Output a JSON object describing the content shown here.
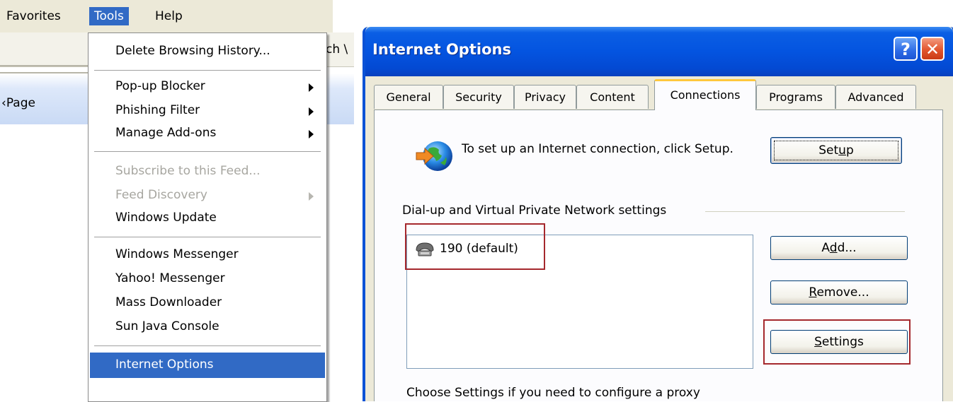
{
  "menubar": {
    "items": [
      "Favorites",
      "Tools",
      "Help"
    ]
  },
  "toolbar": {
    "page_label": "Page",
    "page_prefix": "‹",
    "search_fragment": "ch \\"
  },
  "tools_menu": {
    "items": [
      {
        "label": "Delete Browsing History...",
        "state": "enabled"
      },
      {
        "label": "Pop-up Blocker",
        "state": "enabled",
        "submenu": true
      },
      {
        "label": "Phishing Filter",
        "state": "enabled",
        "submenu": true
      },
      {
        "label": "Manage Add-ons",
        "state": "enabled",
        "submenu": true
      },
      {
        "label": "Subscribe to this Feed...",
        "state": "disabled"
      },
      {
        "label": "Feed Discovery",
        "state": "disabled",
        "submenu": true
      },
      {
        "label": "Windows Update",
        "state": "enabled"
      },
      {
        "label": "Windows Messenger",
        "state": "enabled"
      },
      {
        "label": "Yahoo! Messenger",
        "state": "enabled"
      },
      {
        "label": "Mass Downloader",
        "state": "enabled"
      },
      {
        "label": "Sun Java Console",
        "state": "enabled"
      },
      {
        "label": "Internet Options",
        "state": "selected"
      }
    ]
  },
  "dialog": {
    "title": "Internet Options",
    "help_glyph": "?",
    "close_glyph": "✕",
    "tabs": [
      "General",
      "Security",
      "Privacy",
      "Content",
      "Connections",
      "Programs",
      "Advanced"
    ],
    "active_tab": "Connections",
    "setup_text": "To set up an Internet connection, click Setup.",
    "setup_button": {
      "before": "Set",
      "mnemonic": "u",
      "after": "p"
    },
    "dialup_heading": "Dial-up and Virtual Private Network settings",
    "connections": [
      "190 (default)"
    ],
    "add_button": {
      "before": "A",
      "mnemonic": "d",
      "after": "d..."
    },
    "remove_button": {
      "before": "",
      "mnemonic": "R",
      "after": "emove..."
    },
    "settings_button": {
      "before": "",
      "mnemonic": "S",
      "after": "ettings"
    },
    "bottom_text": "Choose Settings if you need to configure a proxy"
  },
  "colors": {
    "menu_selection": "#316ac5",
    "titlebar": "#0454e0",
    "highlight_box": "#a5282d",
    "active_tab_accent": "#ffc83c"
  }
}
